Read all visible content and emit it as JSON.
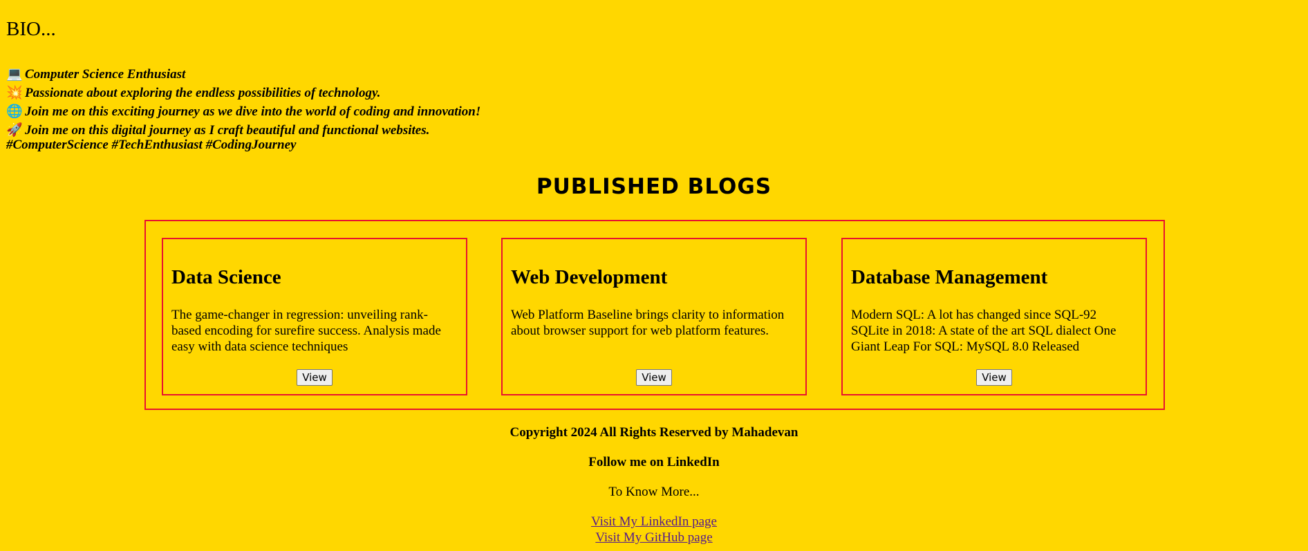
{
  "bio": {
    "title": "BIO...",
    "lines": [
      {
        "icon": "laptop-icon",
        "glyph": "💻",
        "text": "Computer Science Enthusiast"
      },
      {
        "icon": "sparkle-icon",
        "glyph": "💥",
        "text": "Passionate about exploring the endless possibilities of technology."
      },
      {
        "icon": "globe-icon",
        "glyph": "🌐",
        "text": "Join me on this exciting journey as we dive into the world of coding and innovation!"
      },
      {
        "icon": "rocket-icon",
        "glyph": "🚀",
        "text": "Join me on this digital journey as I craft beautiful and functional websites."
      }
    ],
    "hashtags": "#ComputerScience #TechEnthusiast #CodingJourney"
  },
  "blogs": {
    "heading": "PUBLISHED BLOGS",
    "cards": [
      {
        "title": "Data Science",
        "description": "The game-changer in regression: unveiling rank-based encoding for surefire success. Analysis made easy with data science techniques",
        "button": "View"
      },
      {
        "title": "Web Development",
        "description": "Web Platform Baseline brings clarity to information about browser support for web platform features.",
        "button": "View"
      },
      {
        "title": "Database Management",
        "description": "Modern SQL: A lot has changed since SQL-92 SQLite in 2018: A state of the art SQL dialect One Giant Leap For SQL: MySQL 8.0 Released",
        "button": "View"
      }
    ]
  },
  "footer": {
    "copyright": "Copyright 2024 All Rights Reserved by Mahadevan",
    "follow": "Follow me on LinkedIn",
    "know_more": "To Know More...",
    "linkedin_link": "Visit My LinkedIn page",
    "github_link": "Visit My GitHub page"
  },
  "colors": {
    "background": "#FFD700",
    "border": "#E8132F",
    "link": "#551A8B"
  }
}
